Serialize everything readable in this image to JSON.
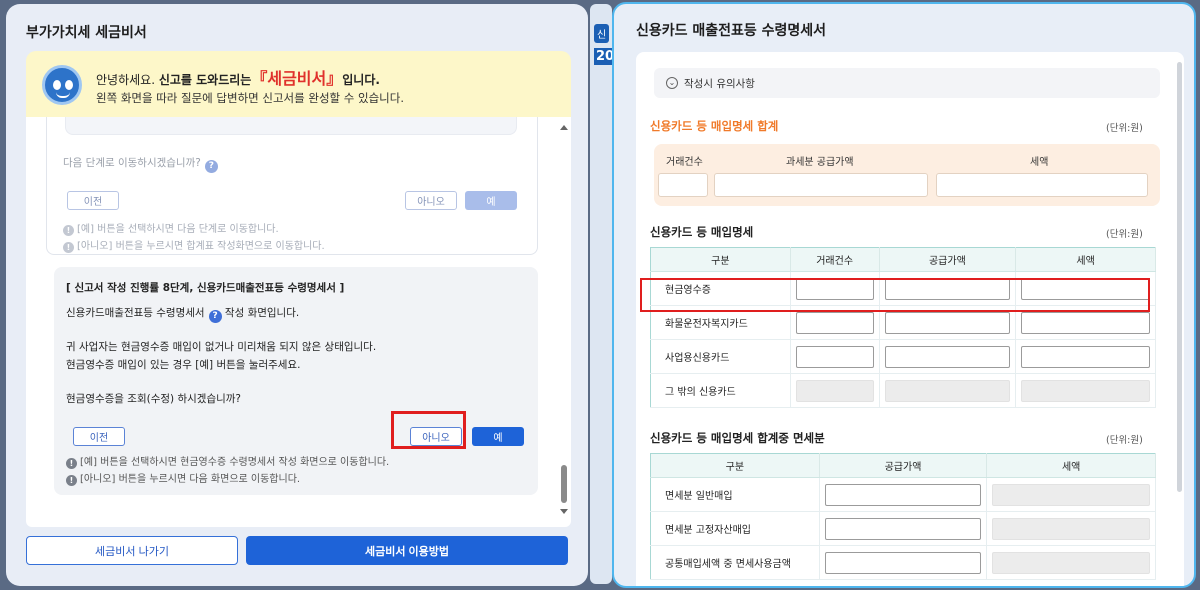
{
  "left": {
    "title": "부가가치세 세금비서",
    "greeting": {
      "hello": "안녕하세요.",
      "intro": "신고를 도와드리는",
      "brand": "『세금비서』",
      "suffix": "입니다.",
      "line2": "왼쪽 화면을 따라 질문에 답변하면 신고서를 완성할 수 있습니다."
    },
    "card1": {
      "question": "다음 단계로 이동하시겠습니까?",
      "prev": "이전",
      "no": "아니오",
      "yes": "예",
      "note1": "[예] 버튼을 선택하시면 다음 단계로 이동합니다.",
      "note2": "[아니오] 버튼을 누르시면 합계표 작성화면으로 이동합니다."
    },
    "card2": {
      "header": "[ 신고서 작성 진행률 8단계, 신용카드매출전표등 수령명세서 ]",
      "line1": "신용카드매출전표등 수령명세서",
      "line1_suffix": "작성 화면입니다.",
      "line2": "귀 사업자는 현금영수증 매입이 없거나 미리채움 되지 않은 상태입니다.",
      "line3": "현금영수증 매입이 있는 경우 [예] 버튼을 눌러주세요.",
      "line4": "현금영수증을 조회(수정) 하시겠습니까?",
      "prev": "이전",
      "no": "아니오",
      "yes": "예",
      "note1": "[예] 버튼을 선택하시면 현금영수증 수령명세서 작성 화면으로 이동합니다.",
      "note2": "[아니오] 버튼을 누르시면 다음 화면으로 이동합니다."
    },
    "footer": {
      "exit": "세금비서 나가기",
      "guide": "세금비서 이용방법"
    }
  },
  "right": {
    "title": "신용카드 매출전표등 수령명세서",
    "guide": "작성시 유의사항",
    "summary": {
      "title": "신용카드 등 매입명세 합계",
      "unit": "(단위:원)",
      "headers": [
        "거래건수",
        "과세분 공급가액",
        "세액"
      ]
    },
    "detail": {
      "title": "신용카드 등 매입명세",
      "unit": "(단위:원)",
      "headers": [
        "구분",
        "거래건수",
        "공급가액",
        "세액"
      ],
      "rows": [
        "현금영수증",
        "화물운전자복지카드",
        "사업용신용카드",
        "그 밖의 신용카드"
      ]
    },
    "exempt": {
      "title": "신용카드 등 매입명세 합계중 면세분",
      "unit": "(단위:원)",
      "headers": [
        "구분",
        "공급가액",
        "세액"
      ],
      "rows": [
        "면세분 일반매입",
        "면세분 고정자산매입",
        "공통매입세액 중 면세사용금액"
      ]
    }
  },
  "colors": {
    "primary": "#1e63d8",
    "highlight": "#e01e1e",
    "orange": "#f07a2a",
    "panel_border": "#4fb6ee"
  }
}
